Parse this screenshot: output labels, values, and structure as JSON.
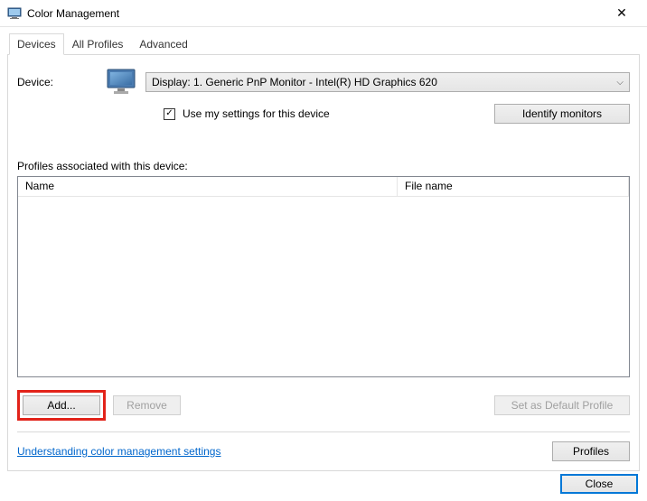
{
  "window": {
    "title": "Color Management"
  },
  "tabs": {
    "devices": "Devices",
    "all_profiles": "All Profiles",
    "advanced": "Advanced"
  },
  "device": {
    "label": "Device:",
    "selected": "Display: 1. Generic PnP Monitor - Intel(R) HD Graphics 620",
    "checkbox_label": "Use my settings for this device",
    "identify": "Identify monitors"
  },
  "profiles": {
    "label": "Profiles associated with this device:",
    "columns": {
      "name": "Name",
      "file": "File name"
    }
  },
  "buttons": {
    "add": "Add...",
    "remove": "Remove",
    "set_default": "Set as Default Profile",
    "profiles": "Profiles",
    "close": "Close"
  },
  "link": "Understanding color management settings"
}
